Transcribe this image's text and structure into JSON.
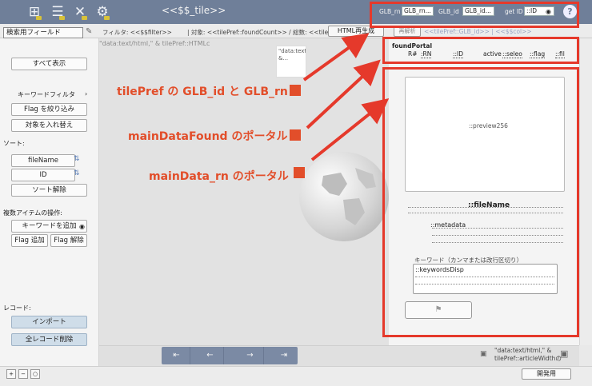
{
  "toolbar": {
    "grid_icon": "grid-icon",
    "list_icon": "list-icon",
    "tools_icon": "tools-icon",
    "gear_icon": "gear-icon"
  },
  "window": {
    "title": "<<$$_tile>>"
  },
  "global_fields": {
    "rn_label": "GLB_rn",
    "rn_value": "GLB_rn...",
    "id_label": "GLB_id",
    "id_value": "GLB_id...",
    "getid_label": "get ID",
    "getid_value": "::ID"
  },
  "row2": {
    "search_select": "検索用フィールド",
    "filter_text": "フィルタ: <<$$filter>>",
    "count_text": "| 対象: <<tilePref::foundCount>> / 総数: <<tilePre",
    "html_button": "HTML再生成",
    "faint_button": "再解析",
    "tail_text": "<<tilePref::GLB_id>> | <<$$col>>"
  },
  "main": {
    "url_text": "\"data:text/html,\" & tilePref::HTMLc",
    "preview_card_text": "\"data:text/html,\" &..."
  },
  "annotations": {
    "a1": "tilePref の GLB_id と GLB_rn",
    "a2": "mainDataFound のポータル",
    "a3": "mainData_rn のポータル"
  },
  "sidebar": {
    "show_all": "すべて表示",
    "keyword_filter": "キーワードフィルタ",
    "flag_filter": "Flag を絞り込み",
    "swap": "対象を入れ替え",
    "sort_label": "ソート:",
    "sort_filename": "fileName",
    "sort_id": "ID",
    "sort_clear": "ソート解除",
    "multi_label": "複数アイテムの操作:",
    "add_keyword": "キーワードを追加",
    "flag_add": "Flag 追加",
    "flag_remove": "Flag 解除",
    "record_label": "レコード:",
    "import": "インポート",
    "delete_all": "全レコード削除"
  },
  "found_portal": {
    "title": "foundPortal",
    "rn": ":RN",
    "id": "::ID",
    "active": "active",
    "sele": "::seleo",
    "flag": "::flag",
    "fil": "::fil"
  },
  "detail": {
    "preview": "::preview256",
    "filename": "::fileName",
    "metadata": "::metadata",
    "keyword_heading": "キーワード（カンマまたは改行区切り）",
    "keywords": "::keywordsDisp",
    "flag_icon": "flag-icon"
  },
  "footer": {
    "first": "⇤",
    "prev": "←",
    "next": "→",
    "last": "⇥",
    "side_text_1": "\"data:text/html,\" &",
    "side_text_2": "tilePref::articleWidthの",
    "dev_button": "開発用"
  },
  "colors": {
    "toolbar_bg": "#6f7f99",
    "annotation_red": "#e24e2a",
    "frame_red": "#e5392b"
  }
}
